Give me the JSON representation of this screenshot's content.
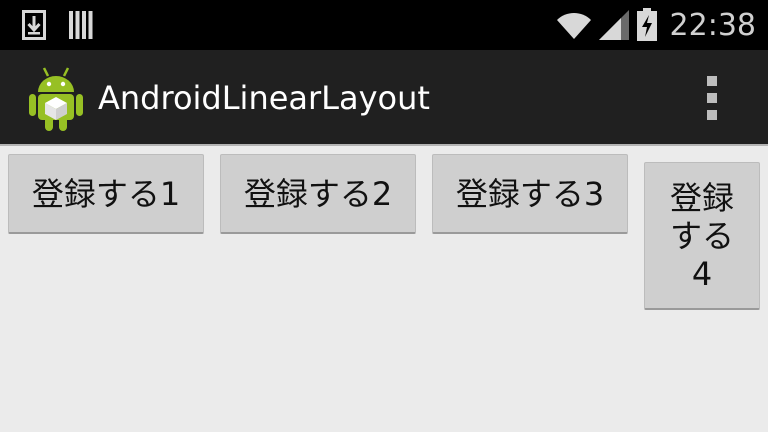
{
  "status_bar": {
    "icons_left": [
      "download-icon",
      "storage-icon"
    ],
    "icons_right": [
      "wifi-icon",
      "signal-icon",
      "battery-charging-icon"
    ],
    "time": "22:38"
  },
  "action_bar": {
    "title": "AndroidLinearLayout",
    "app_icon": "android-robot-icon",
    "overflow_icon": "overflow-menu-icon"
  },
  "buttons": [
    {
      "label": "登録する1"
    },
    {
      "label": "登録する2"
    },
    {
      "label": "登録する3"
    },
    {
      "label": "登録する4"
    }
  ],
  "colors": {
    "status_bar_bg": "#000000",
    "action_bar_bg": "#202020",
    "content_bg": "#ebebeb",
    "button_bg": "#cfcfcf",
    "android_green": "#97c024"
  }
}
